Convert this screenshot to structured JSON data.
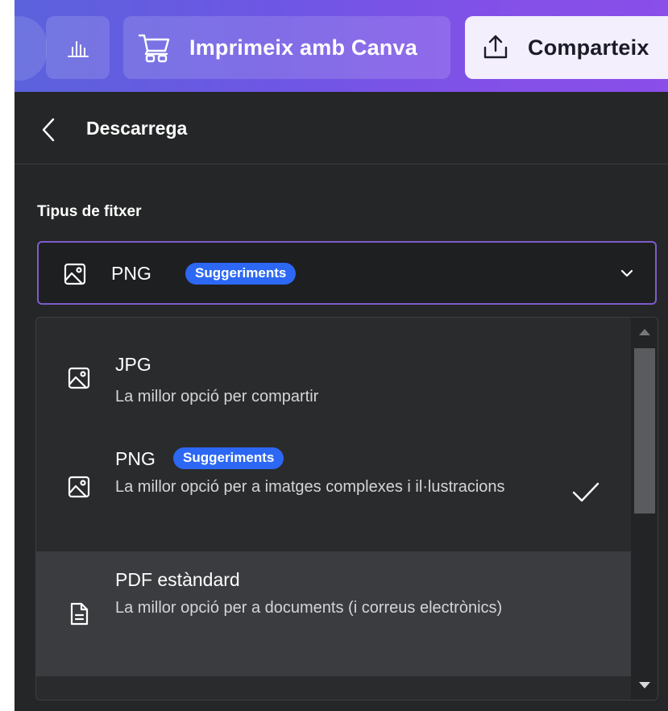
{
  "topbar": {
    "print_label": "Imprimeix amb Canva",
    "share_label": "Comparteix"
  },
  "header": {
    "title": "Descarrega"
  },
  "file_type": {
    "label": "Tipus de fitxer",
    "selected": "PNG",
    "selected_badge": "Suggeriments"
  },
  "options": [
    {
      "name": "JPG",
      "desc": "La millor opció per compartir",
      "icon": "image-icon"
    },
    {
      "name": "PNG",
      "badge": "Suggeriments",
      "desc": "La millor opció per a imatges complexes i il·lustracions",
      "icon": "image-icon",
      "selected": true
    },
    {
      "name": "PDF estàndard",
      "desc": "La millor opció per a documents (i correus electrònics)",
      "icon": "document-icon",
      "highlighted": true
    }
  ],
  "colors": {
    "accent_gradient_start": "#5b62dc",
    "accent_gradient_end": "#8a4ee9",
    "badge": "#2c68f4",
    "panel": "#252627",
    "select_border": "#7d5ccc"
  }
}
